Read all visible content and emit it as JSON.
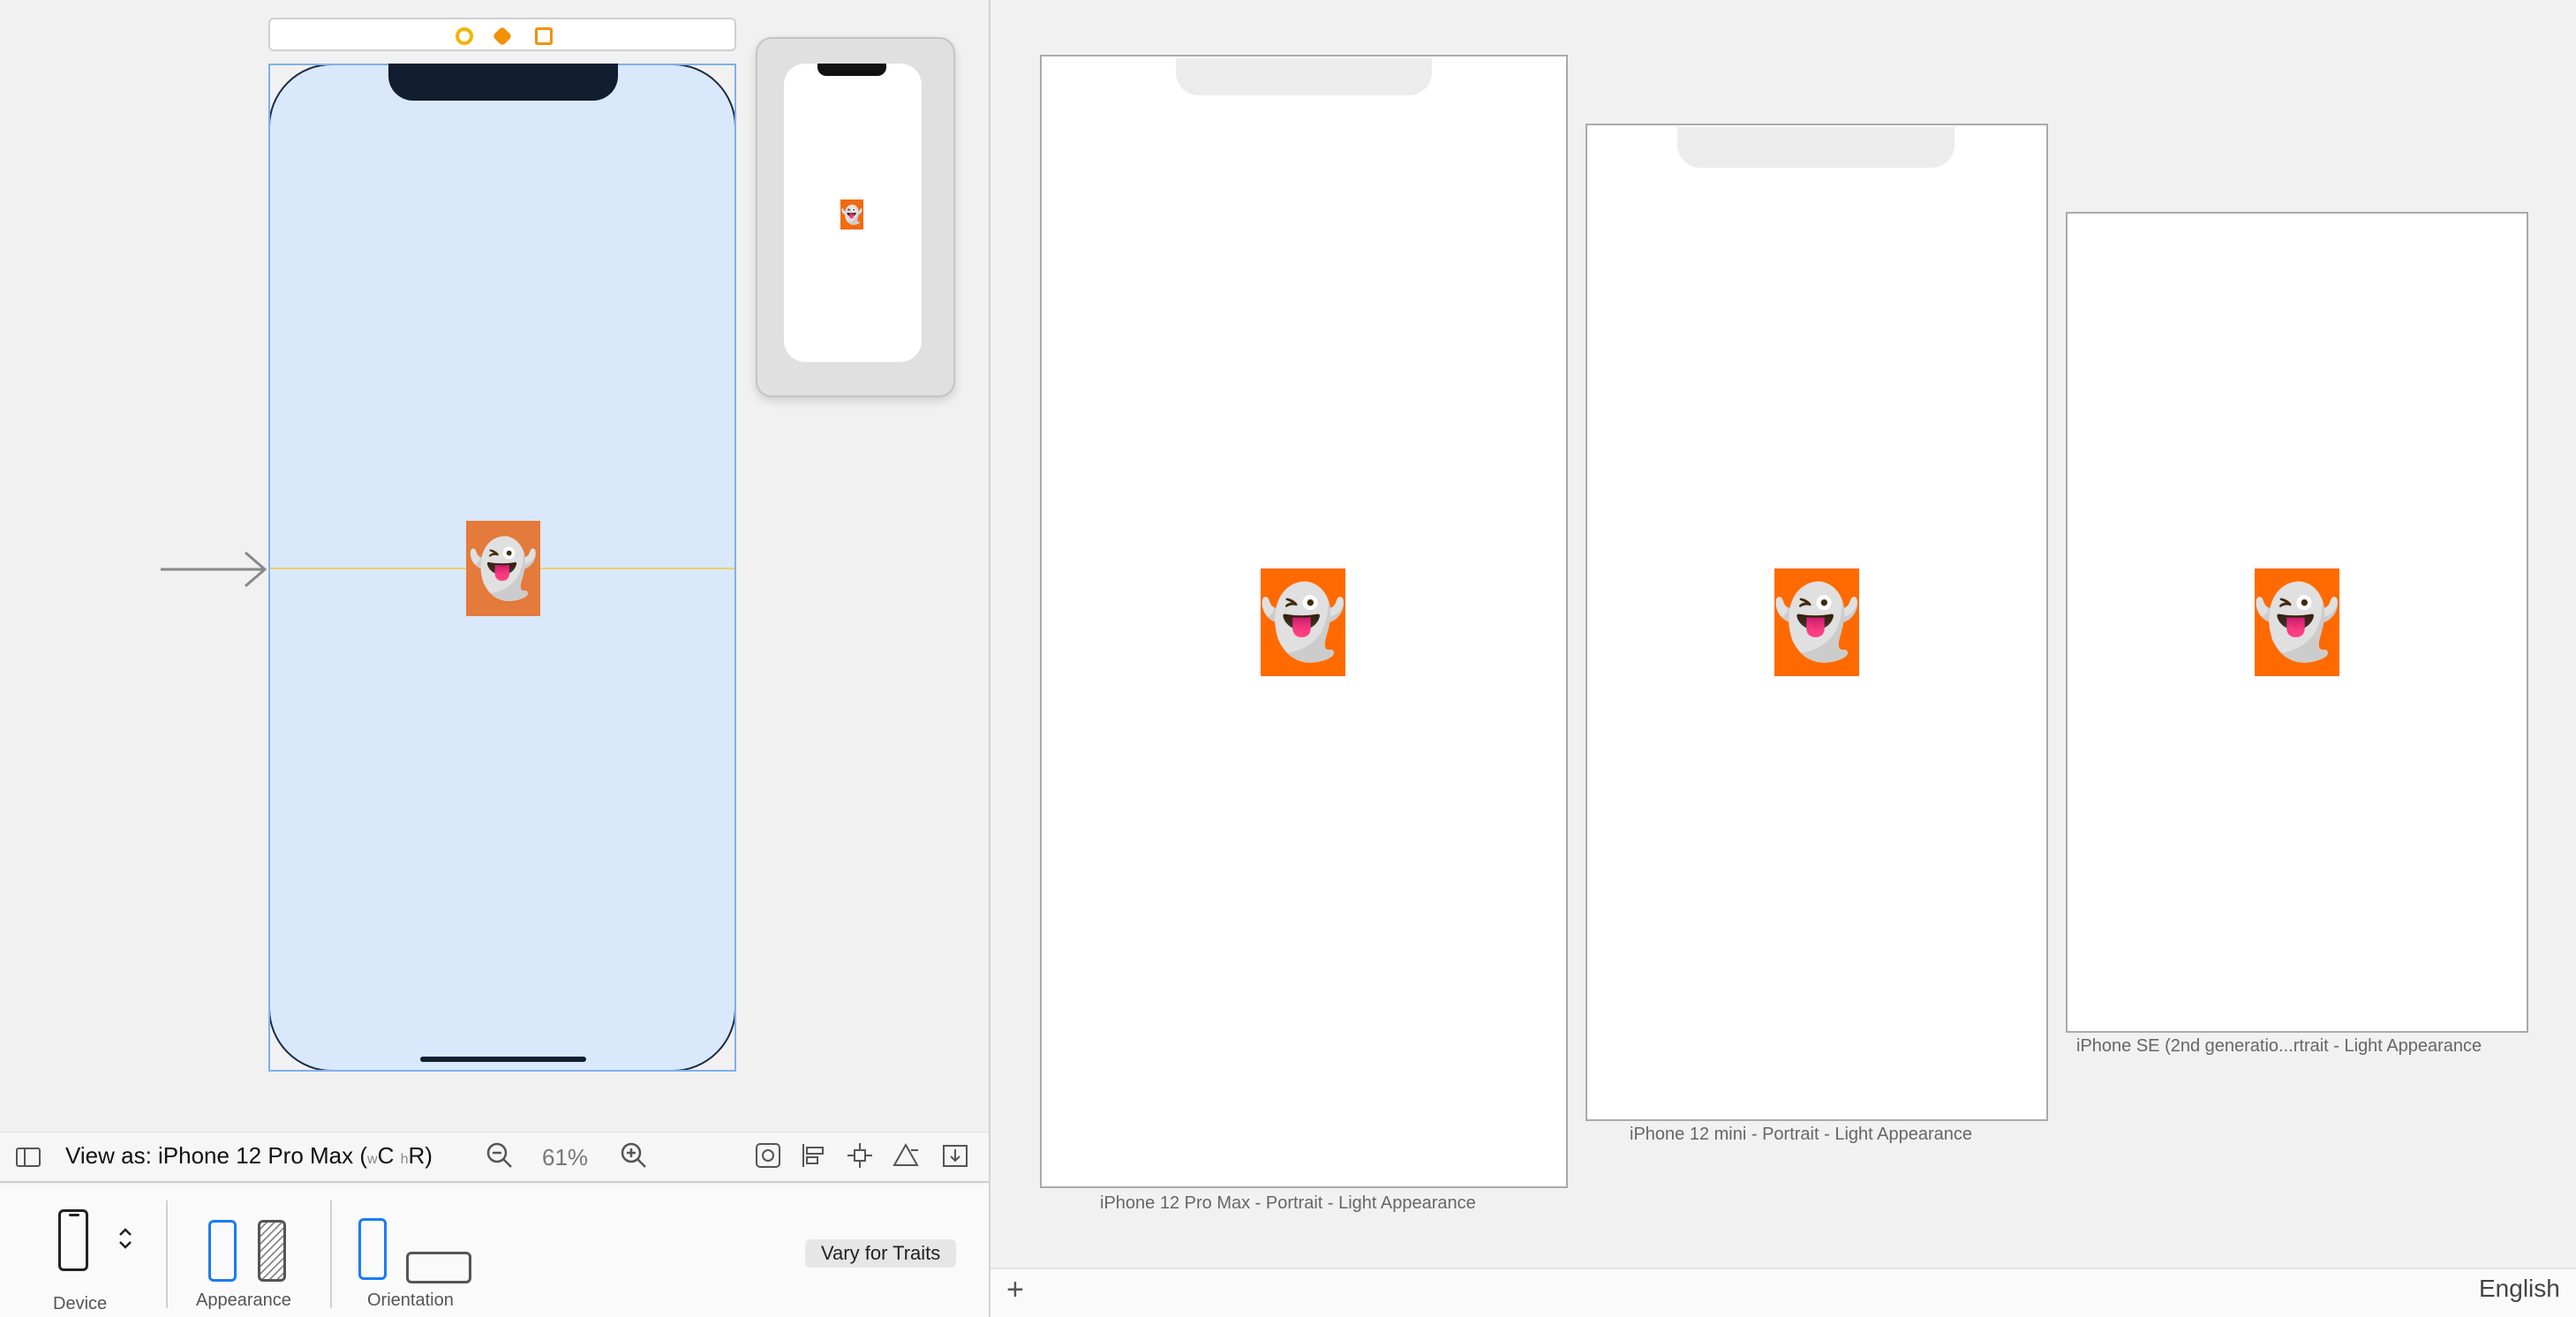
{
  "toolbar": {
    "view_as_prefix": "View as: iPhone 12 Pro Max (",
    "w_size_prefix": "w",
    "w_size": "C",
    "h_size_prefix": "h",
    "h_size": "R",
    "view_as_suffix": ")",
    "zoom_level": "61%"
  },
  "traits": {
    "device_label": "Device",
    "appearance_label": "Appearance",
    "orientation_label": "Orientation",
    "vary_button": "Vary for Traits"
  },
  "canvas": {
    "ghost_emoji": "👻",
    "entry_point_arrow": "initial-view-controller-arrow"
  },
  "previews": [
    {
      "caption": "iPhone 12 Pro Max - Portrait - Light Appearance",
      "ghost": "👻"
    },
    {
      "caption": "iPhone 12 mini - Portrait - Light Appearance",
      "ghost": "👻"
    },
    {
      "caption": "iPhone SE (2nd generatio...rtrait - Light Appearance",
      "ghost": "👻"
    }
  ],
  "footer": {
    "add_label": "+",
    "language": "English"
  },
  "colors": {
    "canvas_view_background": "#d9e8fb",
    "ghost_background": "#ff6a00",
    "selection_blue": "#1a7cf5"
  },
  "icons": [
    "sidebar-toggle-icon",
    "zoom-out-icon",
    "zoom-in-icon",
    "refresh-layout-icon",
    "align-icon",
    "pin-icon",
    "resolve-issues-icon",
    "embed-icon",
    "stepper-icon",
    "view-controller-icon",
    "first-responder-icon",
    "exit-icon"
  ]
}
